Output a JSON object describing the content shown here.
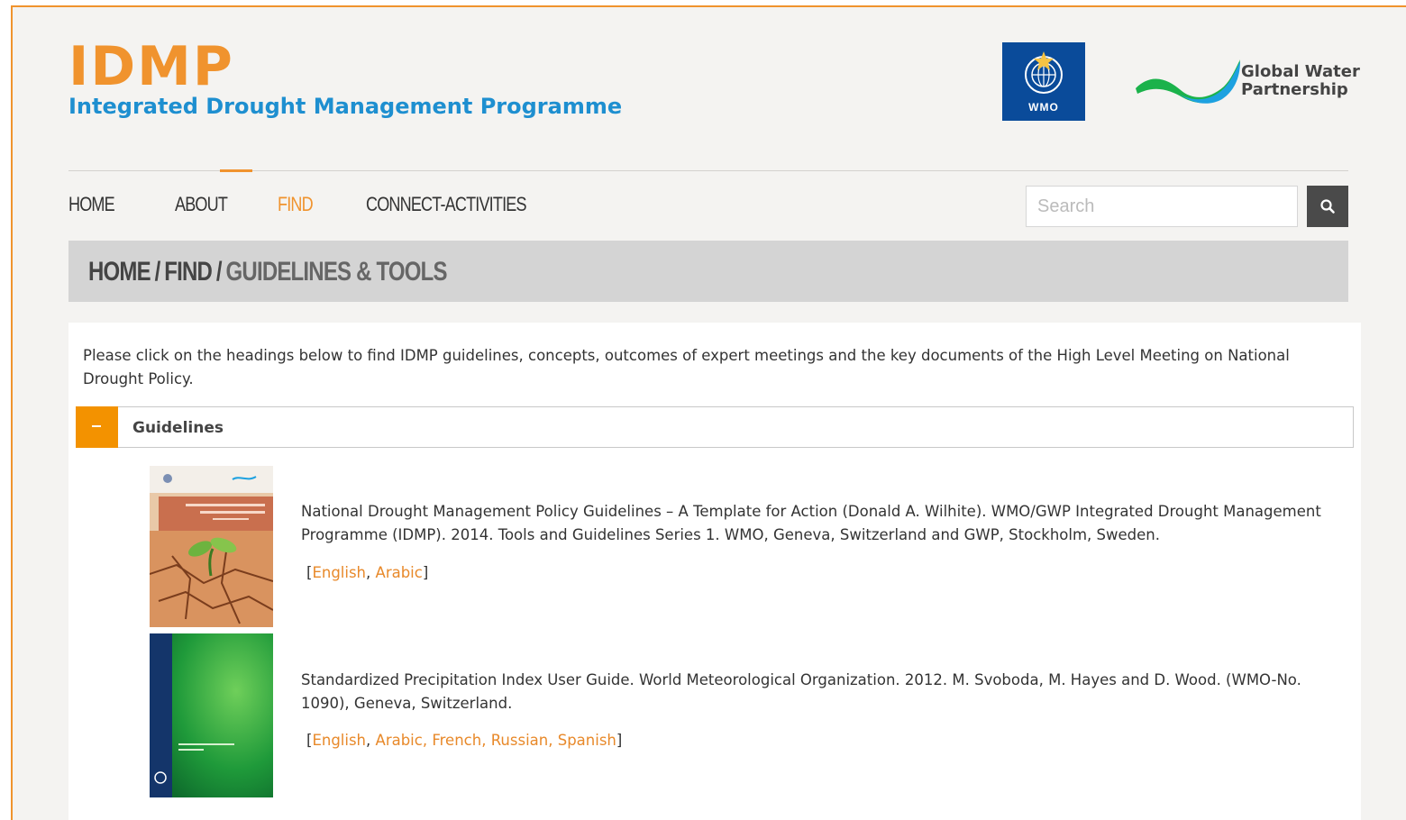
{
  "header": {
    "logo_title": "IDMP",
    "logo_subtitle": "Integrated Drought Management Programme",
    "wmo_label": "WMO",
    "gwp_line1": "Global Water",
    "gwp_line2": "Partnership"
  },
  "nav": {
    "items": [
      {
        "label": "HOME"
      },
      {
        "label": "ABOUT"
      },
      {
        "label": "FIND"
      },
      {
        "label": "CONNECT-ACTIVITIES"
      }
    ],
    "active": "FIND"
  },
  "search": {
    "placeholder": "Search",
    "value": "",
    "button_icon": "search-icon"
  },
  "breadcrumb": {
    "items": [
      "HOME",
      "FIND",
      "GUIDELINES & TOOLS"
    ],
    "separator": "/"
  },
  "content": {
    "intro": "Please click on the headings below to find IDMP guidelines, concepts, outcomes of expert meetings and the key documents of the High Level Meeting on National Drought Policy.",
    "accordion": {
      "title": "Guidelines",
      "state": "expanded"
    },
    "entries": [
      {
        "text": "National Drought Management Policy Guidelines – A Template for Action (Donald A. Wilhite). WMO/GWP Integrated Drought Management Programme (IDMP). 2014. Tools and Guidelines Series 1. WMO, Geneva, Switzerland and GWP, Stockholm, Sweden.",
        "languages": [
          "English",
          "Arabic"
        ]
      },
      {
        "text": "Standardized Precipitation Index User Guide. World Meteorological Organization. 2012. M. Svoboda, M. Hayes and D. Wood. (WMO-No. 1090), Geneva, Switzerland.",
        "languages": [
          "English",
          "Arabic",
          "French",
          "Russian",
          "Spanish"
        ]
      }
    ]
  },
  "colors": {
    "accent": "#f0932e",
    "brand_blue": "#1e8fd0",
    "wmo_blue": "#0a4b9a",
    "breadcrumb_bg": "#d4d4d4",
    "accordion_toggle": "#f39200"
  }
}
